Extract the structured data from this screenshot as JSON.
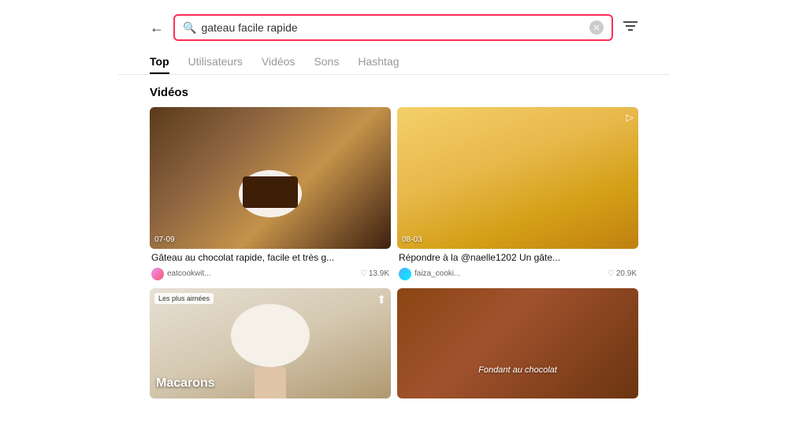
{
  "header": {
    "back_label": "←",
    "search_value": "gateau facile rapide",
    "search_placeholder": "gateau facile rapide",
    "filter_icon": "≡"
  },
  "tabs": {
    "items": [
      {
        "id": "top",
        "label": "Top",
        "active": true
      },
      {
        "id": "utilisateurs",
        "label": "Utilisateurs",
        "active": false
      },
      {
        "id": "videos",
        "label": "Vidéos",
        "active": false
      },
      {
        "id": "sons",
        "label": "Sons",
        "active": false
      },
      {
        "id": "hashtag",
        "label": "Hashtag",
        "active": false
      }
    ]
  },
  "main": {
    "section_title": "Vidéos",
    "videos": [
      {
        "id": "v1",
        "title": "Gâteau au chocolat rapide, facile et très g...",
        "author": "eatcookwit...",
        "likes": "13.9K",
        "timestamp": "07-09",
        "badge": "",
        "type": "chocolate"
      },
      {
        "id": "v2",
        "title": "Répondre à la @naelle1202 Un gâte...",
        "author": "faiza_cooki...",
        "likes": "20.9K",
        "timestamp": "08-03",
        "badge": "",
        "type": "cake_slice"
      },
      {
        "id": "v3",
        "title": "Macarons",
        "author": "",
        "likes": "",
        "timestamp": "",
        "badge": "Les plus aimées",
        "type": "macarons"
      },
      {
        "id": "v4",
        "title": "Fondant au chocolat",
        "author": "",
        "likes": "",
        "timestamp": "",
        "badge": "",
        "type": "fondant"
      }
    ]
  }
}
